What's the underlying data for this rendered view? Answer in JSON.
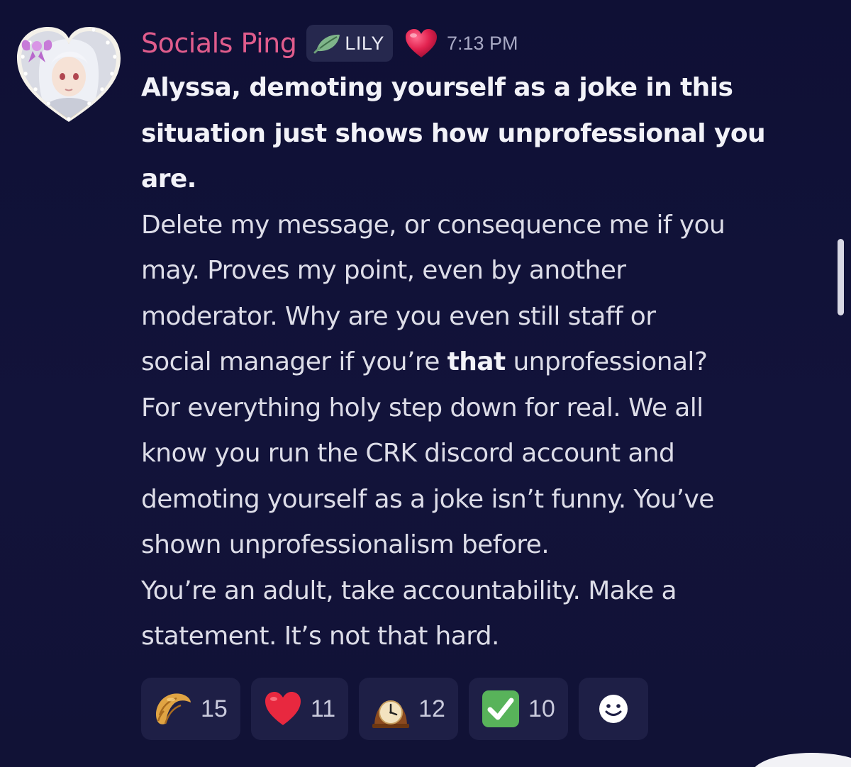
{
  "message": {
    "author": "Socials Ping",
    "author_color": "#e05c8c",
    "role_tag": "LILY",
    "role_icon": "leaf-icon",
    "badge_icon": "heart-icon",
    "timestamp": "7:13 PM",
    "lines": [
      {
        "segments": [
          {
            "text": "Alyssa, demoting yourself as a joke in this",
            "bold": true
          }
        ]
      },
      {
        "segments": [
          {
            "text": "situation just shows how unprofessional you",
            "bold": true
          }
        ]
      },
      {
        "segments": [
          {
            "text": "are.",
            "bold": true
          }
        ]
      },
      {
        "segments": [
          {
            "text": "Delete my message, or consequence me if you",
            "bold": false
          }
        ]
      },
      {
        "segments": [
          {
            "text": "may. Proves my point, even by another",
            "bold": false
          }
        ]
      },
      {
        "segments": [
          {
            "text": "moderator. Why are you even still staff or",
            "bold": false
          }
        ]
      },
      {
        "segments": [
          {
            "text": "social manager if you’re ",
            "bold": false
          },
          {
            "text": "that",
            "bold": true
          },
          {
            "text": " unprofessional?",
            "bold": false
          }
        ]
      },
      {
        "segments": [
          {
            "text": "For everything holy step down for real. We all",
            "bold": false
          }
        ]
      },
      {
        "segments": [
          {
            "text": "know you run the CRK discord account and",
            "bold": false
          }
        ]
      },
      {
        "segments": [
          {
            "text": "demoting yourself as a joke isn’t funny. You’ve",
            "bold": false
          }
        ]
      },
      {
        "segments": [
          {
            "text": "shown unprofessionalism before.",
            "bold": false
          }
        ]
      },
      {
        "segments": [
          {
            "text": "You’re an adult, take accountability. Make a",
            "bold": false
          }
        ]
      },
      {
        "segments": [
          {
            "text": "statement. It’s not that hard.",
            "bold": false
          }
        ]
      }
    ]
  },
  "reactions": [
    {
      "icon": "croissant-icon",
      "count": "15"
    },
    {
      "icon": "heart-icon",
      "count": "11"
    },
    {
      "icon": "mantel-clock-icon",
      "count": "12"
    },
    {
      "icon": "check-mark-icon",
      "count": "10"
    }
  ],
  "add_reaction_icon": "smiley-add-reaction-icon"
}
